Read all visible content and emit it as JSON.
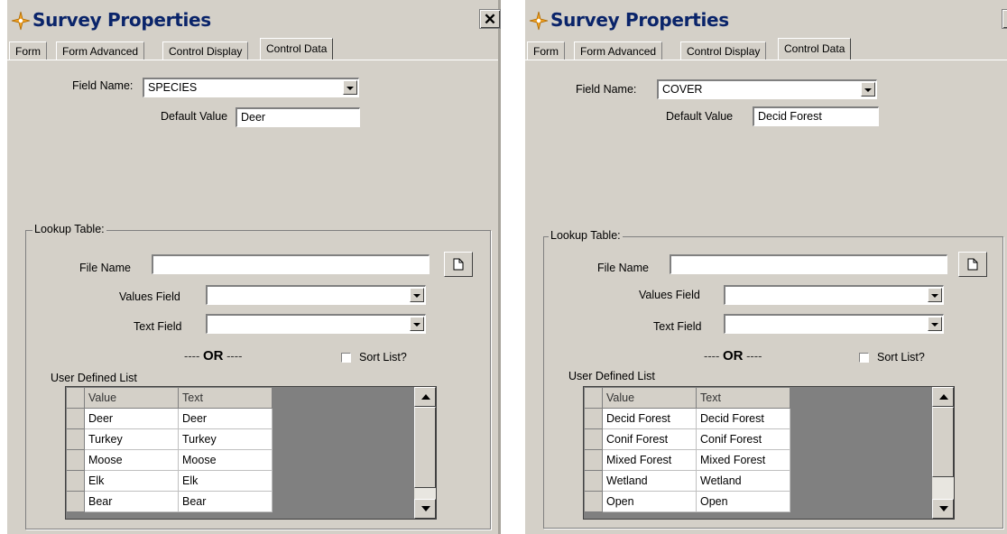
{
  "dialogs": [
    {
      "title": "Survey Properties",
      "tabs": [
        "Form",
        "Form Advanced",
        "Control Display",
        "Control Data"
      ],
      "active_tab": "Control Data",
      "field_name_label": "Field Name:",
      "field_name_value": "SPECIES",
      "default_value_label": "Default Value",
      "default_value": "Deer",
      "lookup_title": "Lookup Table:",
      "file_name_label": "File Name",
      "file_name_value": "",
      "values_field_label": "Values Field",
      "values_field_value": "",
      "text_field_label": "Text Field",
      "text_field_value": "",
      "or_left": "----",
      "or_word": "OR",
      "or_right": "----",
      "sort_label": "Sort List?",
      "user_list_label": "User Defined List",
      "grid": {
        "headers": [
          "Value",
          "Text"
        ],
        "rows": [
          [
            "Deer",
            "Deer"
          ],
          [
            "Turkey",
            "Turkey"
          ],
          [
            "Moose",
            "Moose"
          ],
          [
            "Elk",
            "Elk"
          ],
          [
            "Bear",
            "Bear"
          ]
        ]
      }
    },
    {
      "title": "Survey Properties",
      "tabs": [
        "Form",
        "Form Advanced",
        "Control Display",
        "Control Data"
      ],
      "active_tab": "Control Data",
      "field_name_label": "Field Name:",
      "field_name_value": "COVER",
      "default_value_label": "Default Value",
      "default_value": "Decid Forest",
      "lookup_title": "Lookup Table:",
      "file_name_label": "File Name",
      "file_name_value": "",
      "values_field_label": "Values Field",
      "values_field_value": "",
      "text_field_label": "Text Field",
      "text_field_value": "",
      "or_left": "----",
      "or_word": "OR",
      "or_right": "----",
      "sort_label": "Sort List?",
      "user_list_label": "User Defined List",
      "grid": {
        "headers": [
          "Value",
          "Text"
        ],
        "rows": [
          [
            "Decid Forest",
            "Decid Forest"
          ],
          [
            "Conif Forest",
            "Conif Forest"
          ],
          [
            "Mixed Forest",
            "Mixed Forest"
          ],
          [
            "Wetland",
            "Wetland"
          ],
          [
            "Open",
            "Open"
          ]
        ]
      }
    }
  ],
  "icons": {
    "app": "compass-star-icon",
    "close": "close-icon",
    "browse": "new-document-icon",
    "dropdown": "chevron-down-icon"
  },
  "colors": {
    "title_text": "#0a246a",
    "dialog_bg": "#d4d0c8",
    "grid_empty": "#808080",
    "icon_orange": "#f0a020"
  }
}
